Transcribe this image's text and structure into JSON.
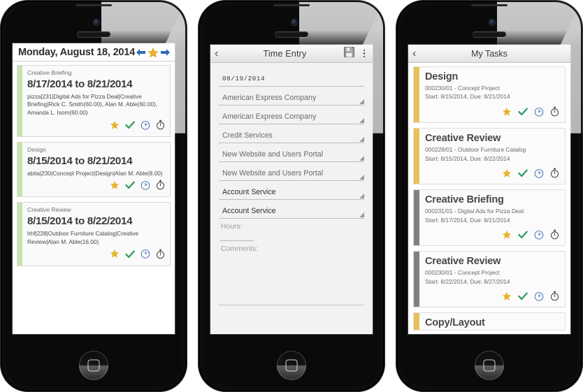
{
  "phones": [
    {
      "id": "calendar-phone",
      "header": {
        "date_label": "Monday, August 18, 2014",
        "nav": {
          "prev_icon": "arrow-left-icon",
          "star_icon": "star-icon",
          "next_icon": "arrow-right-icon"
        }
      },
      "cards": [
        {
          "type": "Creative Briefing",
          "dates": "8/17/2014 to 8/21/2014",
          "meta": "pizza|231|Digital Ads for Pizza Deal|Creative Briefing|Rick C. Smith(60.00), Alan M. Able(60.00), Amanda L. Isom(60.00)",
          "bar_color": "#c5e3ad"
        },
        {
          "type": "Design",
          "dates": "8/15/2014 to 8/21/2014",
          "meta": "abita|230|Concept Project|Design|Alan M. Able(8.00)",
          "bar_color": "#c5e3ad"
        },
        {
          "type": "Creative Review",
          "dates": "8/15/2014 to 8/22/2014",
          "meta": "hhf|228|Outdoor Furniture Catalog|Creative Review|Alan M. Able(16.00)",
          "bar_color": "#c5e3ad"
        }
      ]
    },
    {
      "id": "time-entry-phone",
      "header": {
        "back_label": "‹",
        "title": "Time Entry",
        "save_icon": "save-floppy-icon",
        "overflow_icon": "overflow-menu-icon"
      },
      "fields": [
        {
          "name": "date",
          "value": "08/19/2014",
          "style": "date",
          "dropdown": false
        },
        {
          "name": "client",
          "value": "American Express Company",
          "style": "light",
          "dropdown": true
        },
        {
          "name": "client-secondary",
          "value": "American Express Company",
          "style": "light",
          "dropdown": true
        },
        {
          "name": "division",
          "value": "Credit Services",
          "style": "light",
          "dropdown": true
        },
        {
          "name": "project",
          "value": "New Website and Users Portal",
          "style": "light",
          "dropdown": true
        },
        {
          "name": "project-secondary",
          "value": "New Website and Users Portal",
          "style": "light",
          "dropdown": true
        },
        {
          "name": "task",
          "value": "Account Service",
          "style": "dark",
          "dropdown": true
        },
        {
          "name": "task-secondary",
          "value": "Account Service",
          "style": "dark",
          "dropdown": true
        }
      ],
      "hours_label": "Hours:",
      "hours_value": "",
      "comments_label": "Comments:",
      "comments_value": ""
    },
    {
      "id": "my-tasks-phone",
      "header": {
        "back_label": "‹",
        "title": "My Tasks"
      },
      "tasks": [
        {
          "title": "Design",
          "code": "000230/01 - Concept Project",
          "schedule": "Start: 8/15/2014, Due: 8/21/2014",
          "bar_color": "#e8c157"
        },
        {
          "title": "Creative Review",
          "code": "000228/01 - Outdoor Furniture Catalog",
          "schedule": "Start: 8/15/2014, Due: 8/22/2014",
          "bar_color": "#e8c157"
        },
        {
          "title": "Creative Briefing",
          "code": "000231/01 - Digital Ads for Pizza Deal",
          "schedule": "Start: 8/17/2014, Due: 8/21/2014",
          "bar_color": "#808080"
        },
        {
          "title": "Creative Review",
          "code": "000230/01 - Concept Project",
          "schedule": "Start: 8/22/2014, Due: 8/27/2014",
          "bar_color": "#808080"
        },
        {
          "title": "Copy/Layout",
          "code": "",
          "schedule": "",
          "bar_color": "#e8c157"
        }
      ]
    }
  ],
  "icons": {
    "star": "star-icon",
    "check": "check-icon",
    "clock": "clock-icon",
    "stopwatch": "stopwatch-icon"
  },
  "colors": {
    "star": "#e8b430",
    "check": "#2e9e63",
    "clock_stroke": "#3d6fb4",
    "stopwatch_stroke": "#3a3a3a",
    "calendar_bar": "#c5e3ad",
    "task_bar_gold": "#e8c157",
    "task_bar_gray": "#808080",
    "nav_arrow": "#2f6bb5"
  }
}
